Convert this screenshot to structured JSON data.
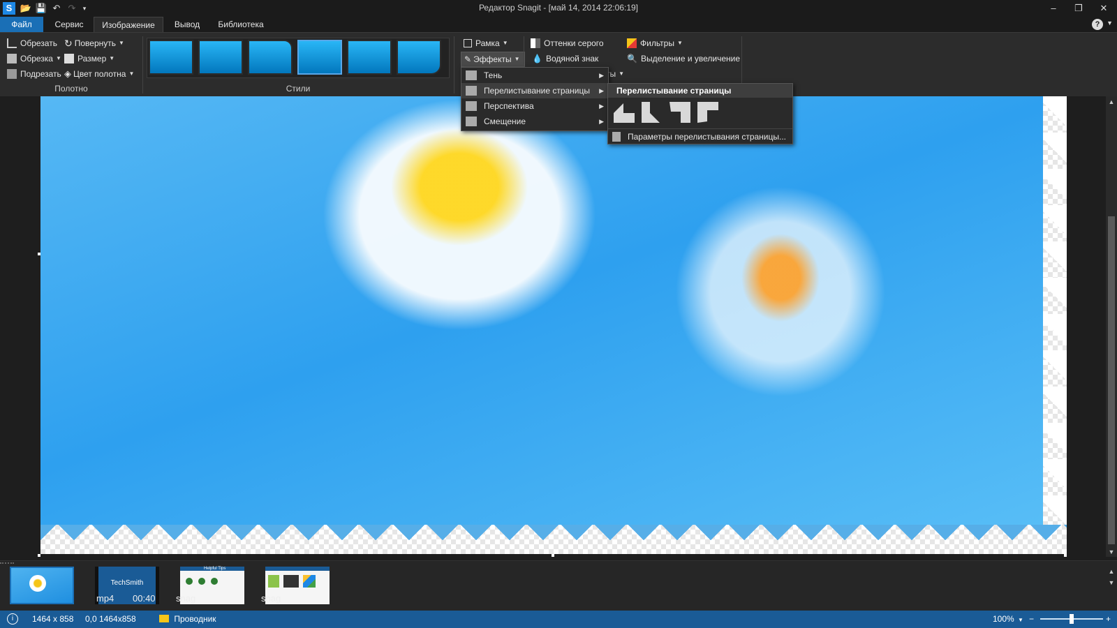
{
  "titlebar": {
    "title": "Редактор Snagit - [май 14, 2014 22:06:19]",
    "app_icon": "S",
    "quick_access": [
      "open-icon",
      "save-icon",
      "undo-icon",
      "redo-icon",
      "customize-icon"
    ],
    "window_controls": {
      "minimize": "–",
      "restore": "❐",
      "close": "✕"
    }
  },
  "tabs": [
    {
      "label": "Файл",
      "active": false
    },
    {
      "label": "Сервис",
      "active": false
    },
    {
      "label": "Изображение",
      "active": true
    },
    {
      "label": "Вывод",
      "active": false
    },
    {
      "label": "Библиотека",
      "active": false
    }
  ],
  "help": {
    "label": "?"
  },
  "ribbon": {
    "canvas_group": {
      "label": "Полотно",
      "crop": "Обрезать",
      "rotate": "Повернуть",
      "cut_out": "Обрезка",
      "resize": "Размер",
      "trim": "Подрезать",
      "canvas_color": "Цвет полотна"
    },
    "styles_group": {
      "label": "Стили",
      "count": 6,
      "selected_index": 3
    },
    "effects_group": {
      "border": "Рамка",
      "effects": "Эффекты",
      "partial_hidden": "ты"
    },
    "other_group": {
      "grayscale": "Оттенки серого",
      "watermark": "Водяной знак",
      "filters": "Фильтры",
      "spotlight": "Выделение и увеличение"
    }
  },
  "effects_menu": {
    "items": [
      {
        "label": "Тень",
        "has_submenu": true,
        "highlighted": false
      },
      {
        "label": "Перелистывание страницы",
        "has_submenu": true,
        "highlighted": true
      },
      {
        "label": "Перспектива",
        "has_submenu": true,
        "highlighted": false
      },
      {
        "label": "Смещение",
        "has_submenu": true,
        "highlighted": false
      }
    ]
  },
  "page_curl_submenu": {
    "header": "Перелистывание страницы",
    "presets": [
      "curl-top-left",
      "curl-top-right",
      "curl-bottom-left",
      "curl-bottom-right"
    ],
    "settings": "Параметры перелистывания страницы..."
  },
  "tray": {
    "items": [
      {
        "type": "image",
        "label": "",
        "selected": true
      },
      {
        "type": "video",
        "label": "mp4",
        "duration": "00:40",
        "brand": "TechSmith"
      },
      {
        "type": "snag",
        "label": "snag",
        "title": "Helpful Tips"
      },
      {
        "type": "snag",
        "label": "snag"
      }
    ]
  },
  "status": {
    "dimensions": "1464 x 858",
    "position": "0,0 1464x858",
    "explorer": "Проводник",
    "zoom": "100%",
    "zoom_minus": "−",
    "zoom_plus": "+",
    "zoom_fraction": 0.5
  },
  "colors": {
    "accent": "#1a6fb6",
    "status_bar": "#1a5b96",
    "ribbon_bg": "#2c2c2c",
    "sky": "#2ea0ef"
  }
}
